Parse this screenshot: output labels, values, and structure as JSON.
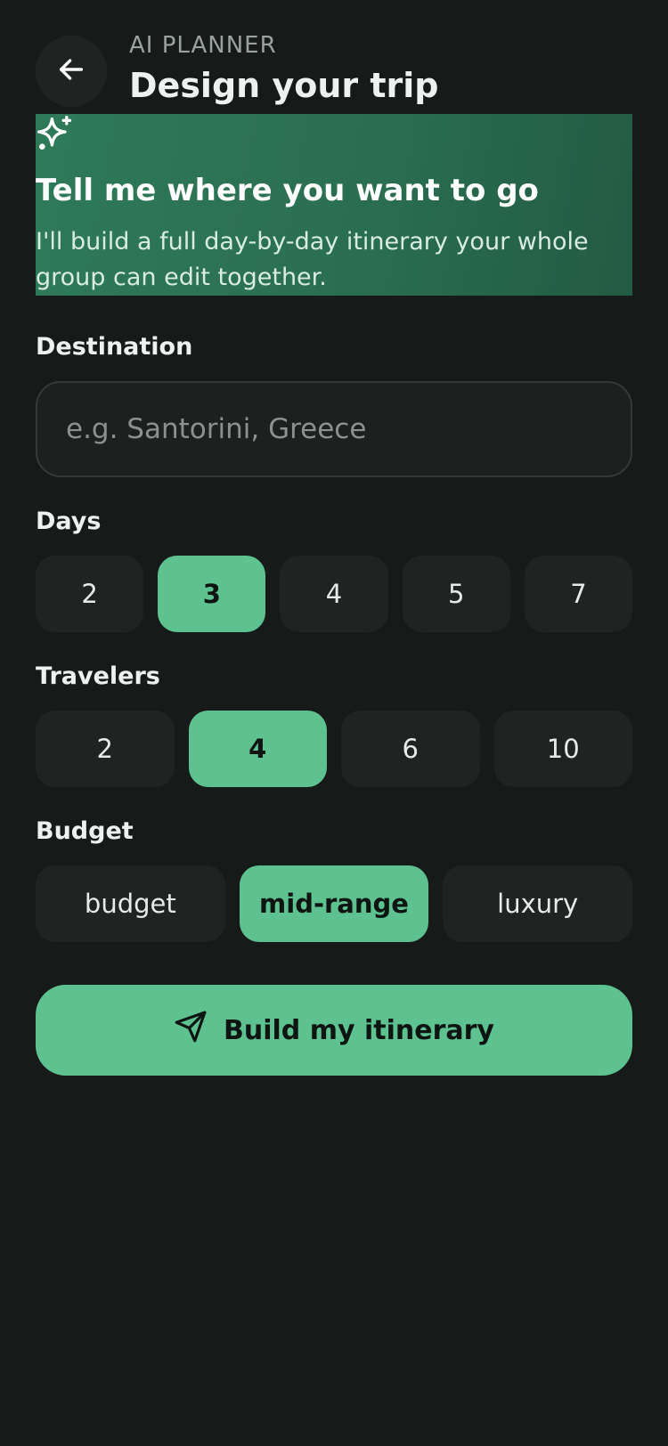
{
  "header": {
    "eyebrow": "AI PLANNER",
    "title": "Design your trip",
    "back_icon": "arrow-left-icon"
  },
  "hero": {
    "icon": "sparkles-icon",
    "title": "Tell me where you want to go",
    "text": "I'll build a full day-by-day itinerary your whole group can edit together."
  },
  "destination": {
    "label": "Destination",
    "value": "",
    "placeholder": "e.g. Santorini, Greece"
  },
  "days": {
    "label": "Days",
    "options": [
      "2",
      "3",
      "4",
      "5",
      "7"
    ],
    "selected": "3"
  },
  "travelers": {
    "label": "Travelers",
    "options": [
      "2",
      "4",
      "6",
      "10"
    ],
    "selected": "4"
  },
  "budget": {
    "label": "Budget",
    "options": [
      "budget",
      "mid-range",
      "luxury"
    ],
    "selected": "mid-range"
  },
  "cta": {
    "label": "Build my itinerary",
    "icon": "send-icon"
  },
  "colors": {
    "background": "#161b1a",
    "accent": "#5dc290",
    "hero": "#2a6e50",
    "chip": "#1f2422"
  }
}
